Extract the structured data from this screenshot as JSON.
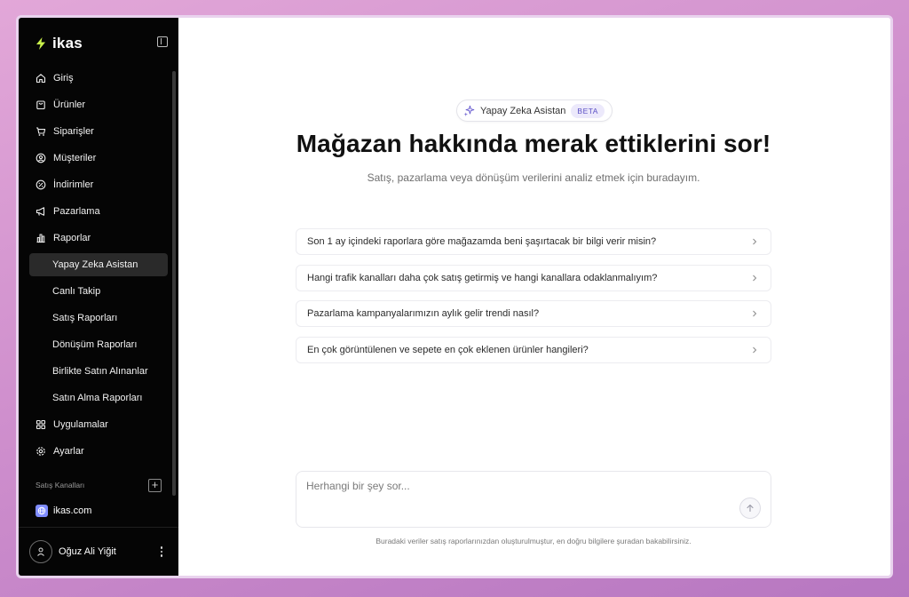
{
  "brand": {
    "name": "ikas",
    "accent": "#c9f24b"
  },
  "sidebar": {
    "items": [
      {
        "label": "Giriş",
        "icon": "home-icon"
      },
      {
        "label": "Ürünler",
        "icon": "bag-icon"
      },
      {
        "label": "Siparişler",
        "icon": "cart-icon"
      },
      {
        "label": "Müşteriler",
        "icon": "user-circle-icon"
      },
      {
        "label": "İndirimler",
        "icon": "discount-icon"
      },
      {
        "label": "Pazarlama",
        "icon": "megaphone-icon"
      },
      {
        "label": "Raporlar",
        "icon": "chart-icon"
      },
      {
        "label": "Yapay Zeka Asistan",
        "active": true
      },
      {
        "label": "Canlı Takip"
      },
      {
        "label": "Satış Raporları"
      },
      {
        "label": "Dönüşüm Raporları"
      },
      {
        "label": "Birlikte Satın Alınanlar"
      },
      {
        "label": "Satın Alma Raporları"
      },
      {
        "label": "Uygulamalar",
        "icon": "grid-icon"
      },
      {
        "label": "Ayarlar",
        "icon": "gear-icon"
      }
    ],
    "sales_channels_label": "Satış Kanalları",
    "channel": {
      "label": "ikas.com",
      "icon": "globe-icon"
    },
    "user": {
      "name": "Oğuz Ali Yiğit"
    }
  },
  "main": {
    "badge": {
      "label": "Yapay Zeka Asistan",
      "tag": "BETA"
    },
    "headline": "Mağazan hakkında merak ettiklerini sor!",
    "subline": "Satış, pazarlama veya dönüşüm verilerini analiz etmek için buradayım.",
    "suggestions": [
      "Son 1 ay içindeki raporlara göre mağazamda beni şaşırtacak bir bilgi verir misin?",
      "Hangi trafik kanalları daha çok satış getirmiş ve hangi kanallara odaklanmalıyım?",
      "Pazarlama kampanyalarımızın aylık gelir trendi nasıl?",
      "En çok görüntülenen ve sepete en çok eklenen ürünler hangileri?"
    ],
    "composer": {
      "placeholder": "Herhangi bir şey sor...",
      "value": ""
    },
    "footnote": "Buradaki veriler satış raporlarınızdan oluşturulmuştur, en doğru bilgilere şuradan bakabilirsiniz."
  },
  "colors": {
    "sidebar_bg": "#050505",
    "active_item_bg": "#2a2a2a",
    "beta_bg": "#ece9fb",
    "beta_text": "#5b4fc4"
  }
}
